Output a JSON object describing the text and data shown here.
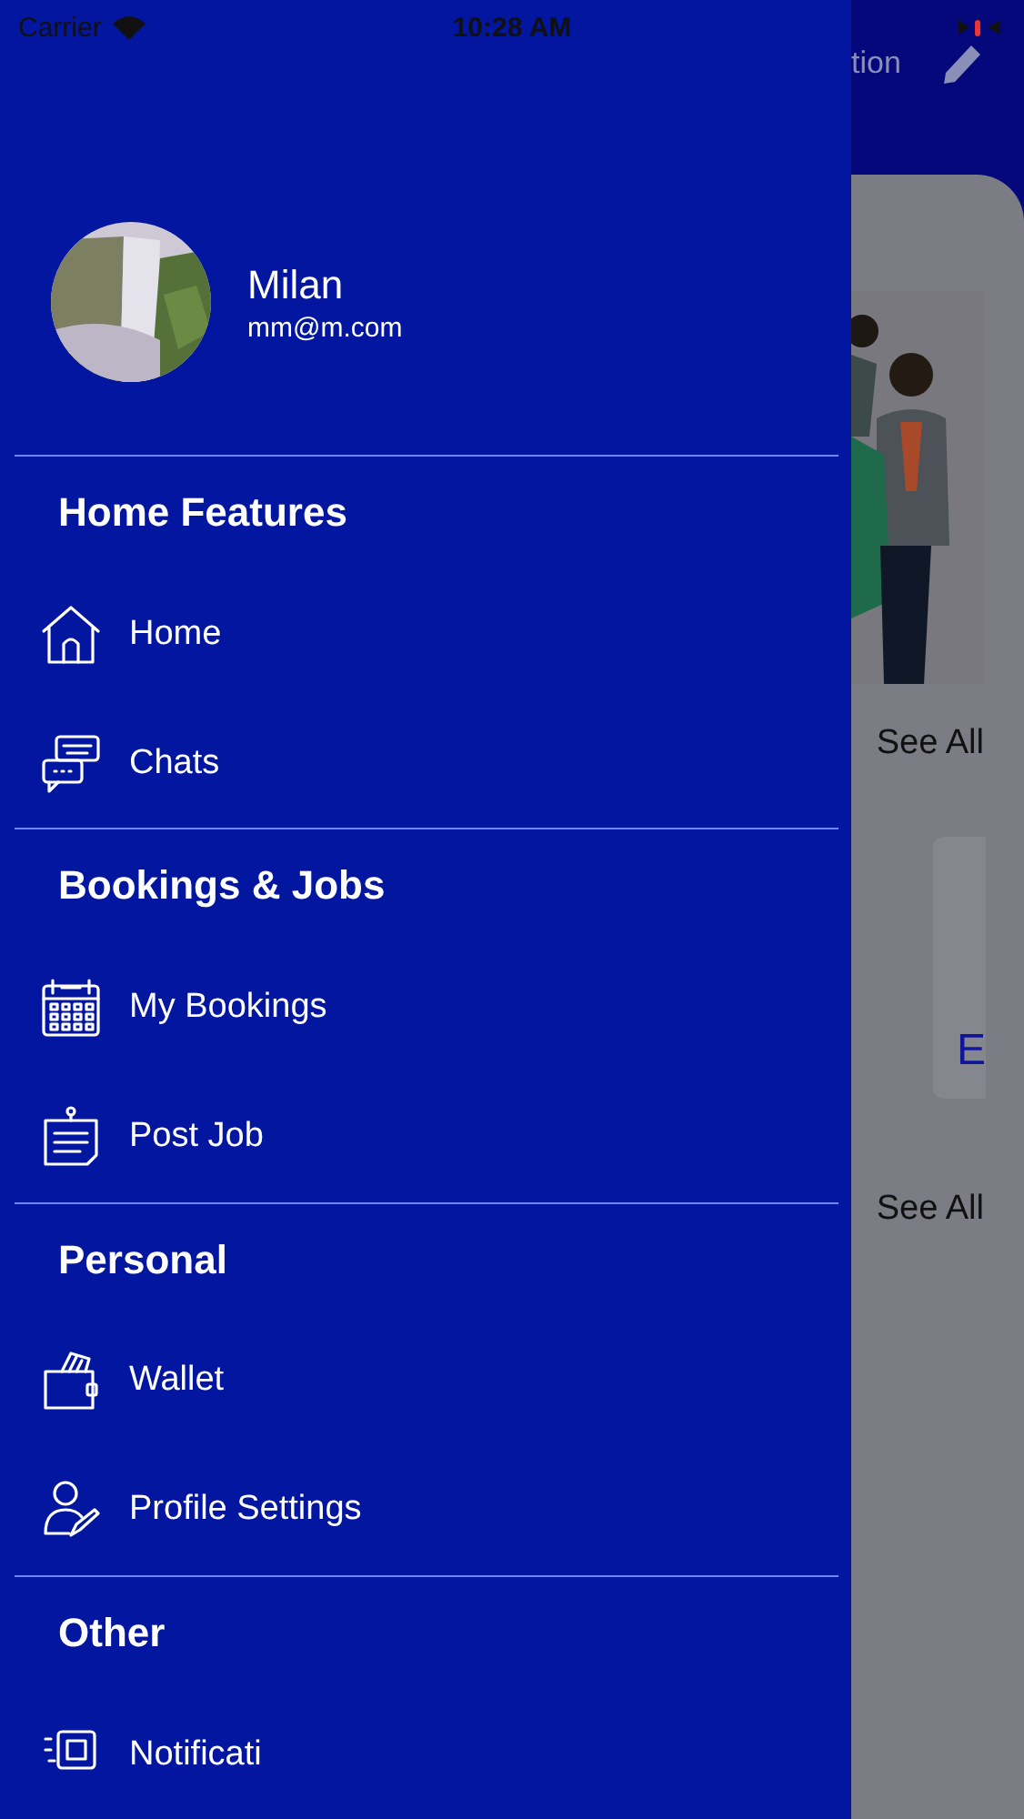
{
  "status_bar": {
    "carrier": "Carrier",
    "time": "10:28 AM"
  },
  "background": {
    "header_title": "tion",
    "see_all_links": [
      "See All",
      "See All"
    ],
    "card_letter": "E"
  },
  "profile": {
    "name": "Milan",
    "email": "mm@m.com"
  },
  "sections": [
    {
      "title": "Home Features",
      "items": [
        {
          "label": "Home"
        },
        {
          "label": "Chats"
        }
      ]
    },
    {
      "title": "Bookings & Jobs",
      "items": [
        {
          "label": "My Bookings"
        },
        {
          "label": "Post Job"
        }
      ]
    },
    {
      "title": "Personal",
      "items": [
        {
          "label": "Wallet"
        },
        {
          "label": "Profile Settings"
        }
      ]
    },
    {
      "title": "Other",
      "items": [
        {
          "label": "Notificati"
        }
      ]
    }
  ]
}
